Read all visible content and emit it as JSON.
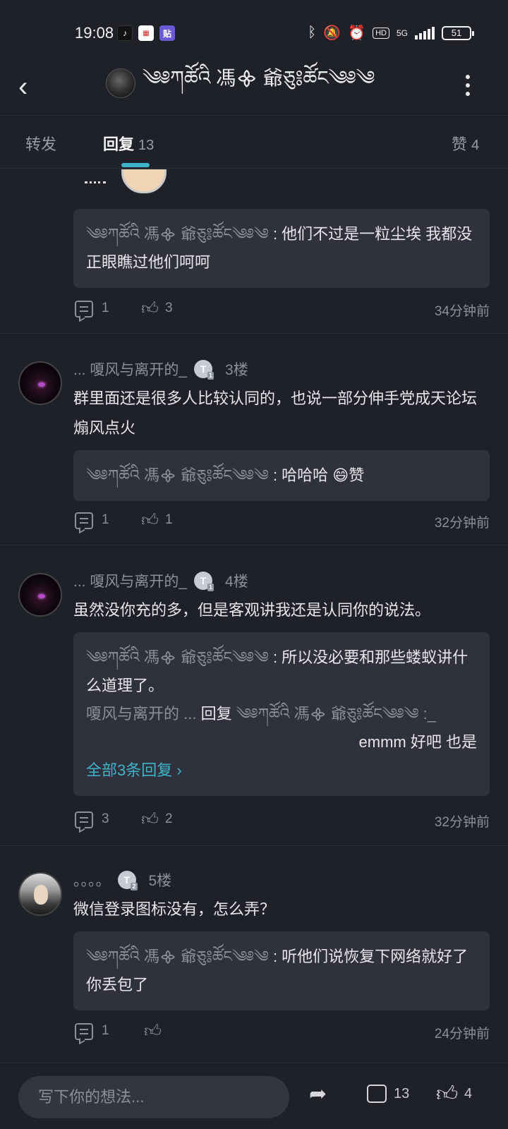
{
  "status_bar": {
    "time": "19:08",
    "apps": [
      "douyin",
      "news",
      "贴"
    ],
    "network": "5G",
    "hd": "HD",
    "battery": "51"
  },
  "header": {
    "title": "༄༅ཀཚོའི 馮᯽ 爺ཅུ༔ཚོང༄༅༄"
  },
  "tabs": [
    {
      "label": "转发",
      "count": ""
    },
    {
      "label": "回复",
      "count": "13"
    },
    {
      "label": "赞",
      "count": "4"
    }
  ],
  "posts": [
    {
      "author": "",
      "floor": "",
      "text": "",
      "quote": {
        "name": "༄༅ཀཚོའི 馮᯽ 爺ཅུ༔ཚོང༄༅༄",
        "text": "他们不过是一粒尘埃 我都没正眼瞧过他们呵呵"
      },
      "comments": "1",
      "likes": "3",
      "time": "34分钟前"
    },
    {
      "author": "... 嗄风与离开的_",
      "floor": "3楼",
      "text": "群里面还是很多人比较认同的，也说一部分伸手党成天论坛煽风点火",
      "quote": {
        "name": "༄༅ཀཚོའི 馮᯽ 爺ཅུ༔ཚོང༄༅༄",
        "text": "哈哈哈 😄赞"
      },
      "comments": "1",
      "likes": "1",
      "time": "32分钟前"
    },
    {
      "author": "... 嗄风与离开的_",
      "floor": "4楼",
      "text": "虽然没你充的多，但是客观讲我还是认同你的说法。",
      "quote": {
        "name": "༄༅ཀཚོའི 馮᯽ 爺ཅུ༔ཚོང༄༅༄",
        "text": "所以没必要和那些蝼蚁讲什么道理了。",
        "sub_from": "嗄风与离开的 ...",
        "sub_verb": "回复",
        "sub_to": "༄༅ཀཚོའི 馮᯽ 爺ཅུ༔ཚོང༄༅༄ :_",
        "sub_text": "emmm 好吧 也是",
        "all_replies": "全部3条回复 ›"
      },
      "comments": "3",
      "likes": "2",
      "time": "32分钟前"
    },
    {
      "author": "。。。。",
      "floor": "5楼",
      "text": "微信登录图标没有，怎么弄？",
      "quote": {
        "name": "༄༅ཀཚོའི 馮᯽ 爺ཅུ༔ཚོང༄༅༄",
        "text": "听他们说恢复下网络就好了 你丢包了"
      },
      "comments": "1",
      "likes": "",
      "time": "24分钟前"
    }
  ],
  "bottom_bar": {
    "placeholder": "写下你的想法...",
    "comment_count": "13",
    "like_count": "4"
  },
  "colors": {
    "background": "#1f2129",
    "card": "#2f323c",
    "accent": "#3fb3c8",
    "muted": "#8c8f99"
  }
}
